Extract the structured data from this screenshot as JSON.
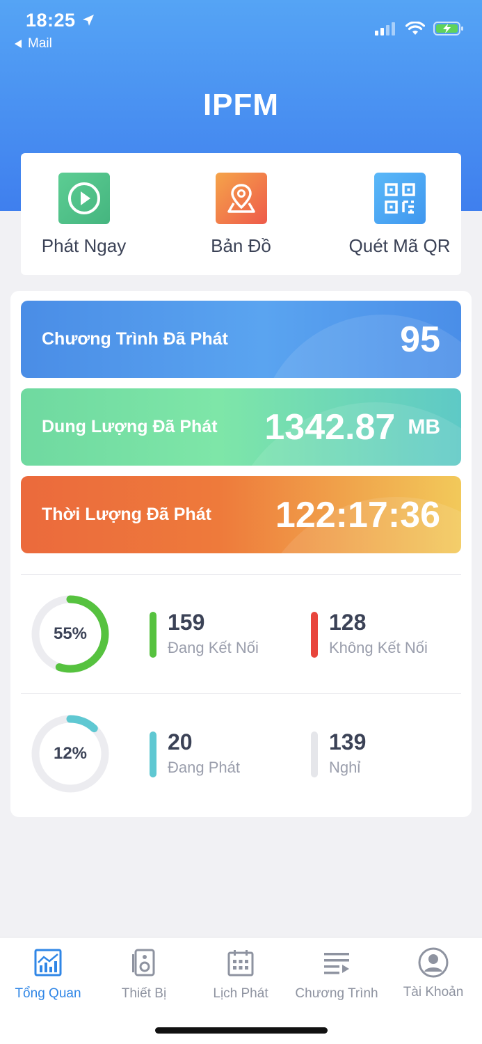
{
  "status_bar": {
    "time": "18:25",
    "back_label": "Mail"
  },
  "header": {
    "title": "IPFM"
  },
  "quick_actions": [
    {
      "label": "Phát Ngay",
      "icon": "play-icon",
      "color": "#4fc08d"
    },
    {
      "label": "Bản Đồ",
      "icon": "map-pin-icon",
      "color": "#f06a4a"
    },
    {
      "label": "Quét Mã QR",
      "icon": "qr-code-icon",
      "color": "#4aa8f5"
    }
  ],
  "stats": [
    {
      "label": "Chương Trình Đã Phát",
      "value": "95",
      "unit": ""
    },
    {
      "label": "Dung Lượng Đã Phát",
      "value": "1342.87",
      "unit": "MB"
    },
    {
      "label": "Thời Lượng Đã Phát",
      "value": "122:17:36",
      "unit": ""
    }
  ],
  "devices": {
    "connection": {
      "percent_label": "55%",
      "percent": 55,
      "ring_color": "#56c23f",
      "items": [
        {
          "value": "159",
          "caption": "Đang Kết Nối",
          "color": "#56c23f"
        },
        {
          "value": "128",
          "caption": "Không Kết Nối",
          "color": "#e8453c"
        }
      ]
    },
    "playing": {
      "percent_label": "12%",
      "percent": 12,
      "ring_color": "#5fc8d2",
      "items": [
        {
          "value": "20",
          "caption": "Đang Phát",
          "color": "#5fc8d2"
        },
        {
          "value": "139",
          "caption": "Nghỉ",
          "color": "#e5e6ea"
        }
      ]
    }
  },
  "tabbar": [
    {
      "label": "Tổng Quan",
      "icon": "chart-icon",
      "active": true
    },
    {
      "label": "Thiết Bị",
      "icon": "speaker-icon",
      "active": false
    },
    {
      "label": "Lịch Phát",
      "icon": "calendar-icon",
      "active": false
    },
    {
      "label": "Chương Trình",
      "icon": "playlist-icon",
      "active": false
    },
    {
      "label": "Tài Khoản",
      "icon": "account-icon",
      "active": false
    }
  ],
  "colors": {
    "header_gradient_top": "#55a4f5",
    "header_gradient_bottom": "#3f7fee",
    "active_tab": "#2f86e6",
    "inactive_tab": "#8e93a0"
  }
}
